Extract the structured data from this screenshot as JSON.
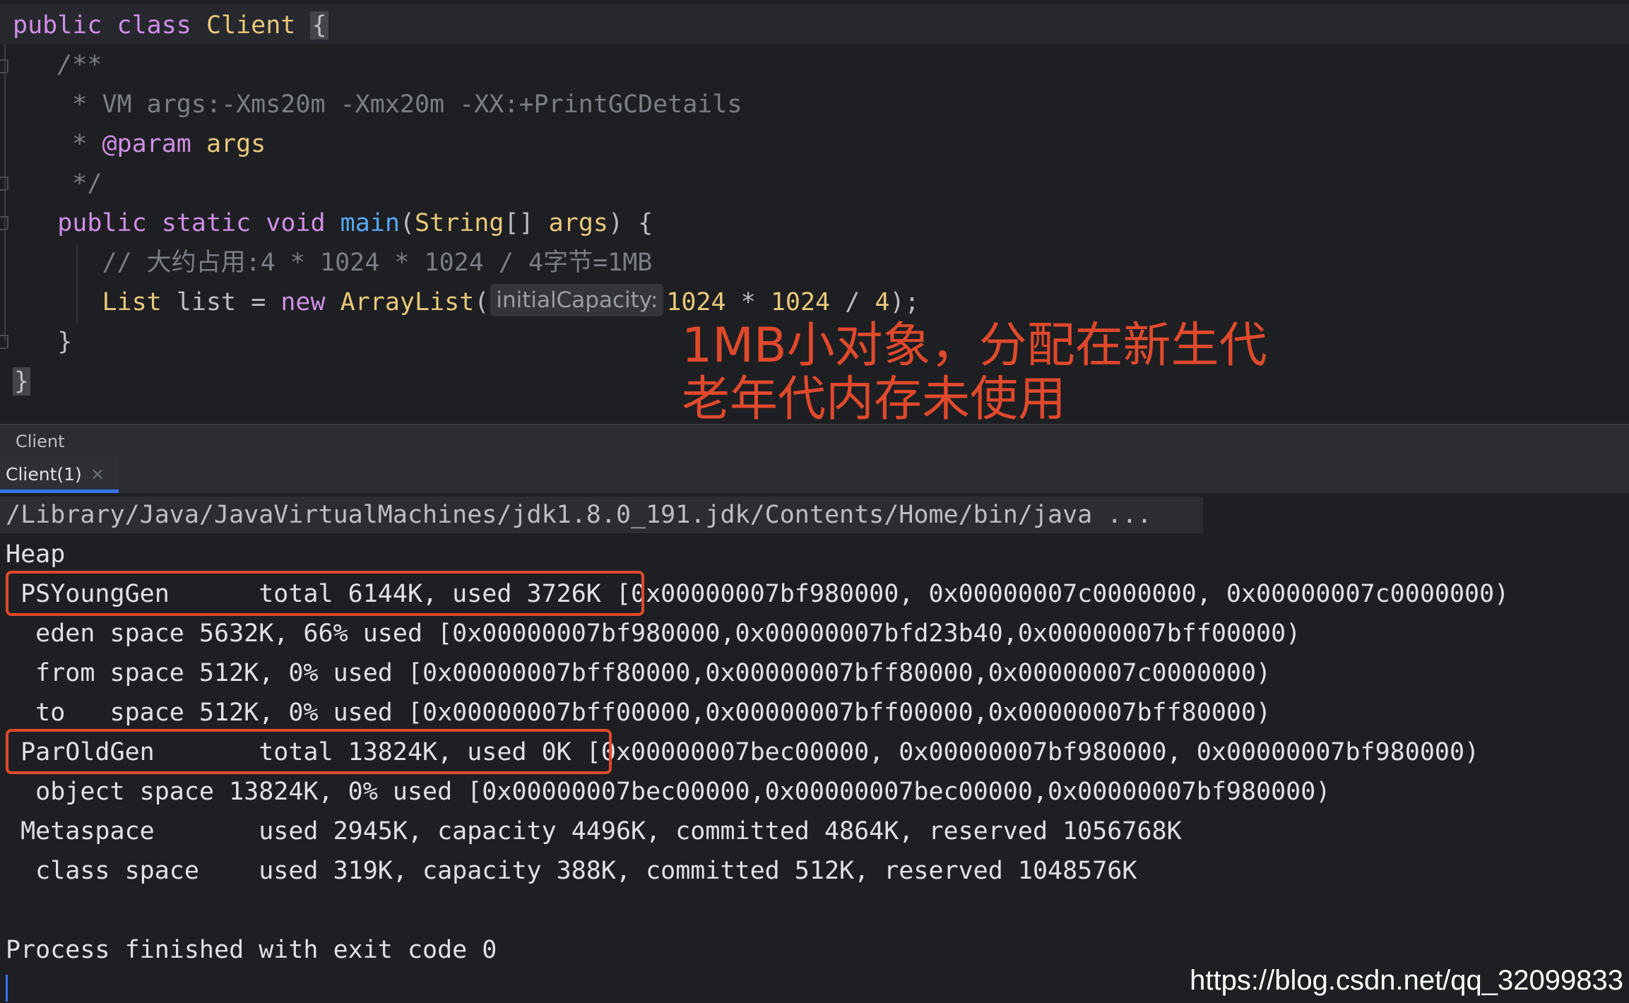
{
  "editor": {
    "class_decl": {
      "kw1": "public",
      "kw2": "class",
      "name": "Client",
      "open": "{"
    },
    "javadoc_open": "/**",
    "javadoc_vm_line": "* VM args:-Xms20m -Xmx20m -XX:+PrintGCDetails",
    "javadoc_star": "*",
    "javadoc_tag": "@param",
    "javadoc_tag_value": "args",
    "javadoc_close": "*/",
    "method_decl": {
      "kw1": "public",
      "kw2": "static",
      "kw3": "void",
      "name": "main",
      "paren_open": "(",
      "param_type": "String",
      "array": "[]",
      "param_name": "args",
      "rest": ") {"
    },
    "comment": "// 大约占用:4 * 1024 * 1024 / 4字节=1MB",
    "stmt": {
      "type": "List",
      "var": "list",
      "assign": "=",
      "kw_new": "new",
      "ctor": "ArrayList",
      "paren_open": "(",
      "hint": "initialCapacity:",
      "num1": "1024",
      "op1": "*",
      "num2": "1024",
      "op2": "/",
      "num3": "4",
      "end": ");"
    },
    "method_close": "}",
    "class_close": "}"
  },
  "annotation": {
    "line1": "1MB小对象，分配在新生代",
    "line2": "老年代内存未使用"
  },
  "run_window": {
    "title": "Client",
    "tab_label": "Client(1)",
    "tab_close": "×"
  },
  "console": {
    "lines": [
      "/Library/Java/JavaVirtualMachines/jdk1.8.0_191.jdk/Contents/Home/bin/java ...",
      "Heap",
      " PSYoungGen      total 6144K, used 3726K [0x00000007bf980000, 0x00000007c0000000, 0x00000007c0000000)",
      "  eden space 5632K, 66% used [0x00000007bf980000,0x00000007bfd23b40,0x00000007bff00000)",
      "  from space 512K, 0% used [0x00000007bff80000,0x00000007bff80000,0x00000007c0000000)",
      "  to   space 512K, 0% used [0x00000007bff00000,0x00000007bff00000,0x00000007bff80000)",
      " ParOldGen       total 13824K, used 0K [0x00000007bec00000, 0x00000007bf980000, 0x00000007bf980000)",
      "  object space 13824K, 0% used [0x00000007bec00000,0x00000007bec00000,0x00000007bf980000)",
      " Metaspace       used 2945K, capacity 4496K, committed 4864K, reserved 1056768K",
      "  class space    used 319K, capacity 388K, committed 512K, reserved 1048576K",
      "",
      "Process finished with exit code 0"
    ]
  },
  "watermark": "https://blog.csdn.net/qq_32099833"
}
